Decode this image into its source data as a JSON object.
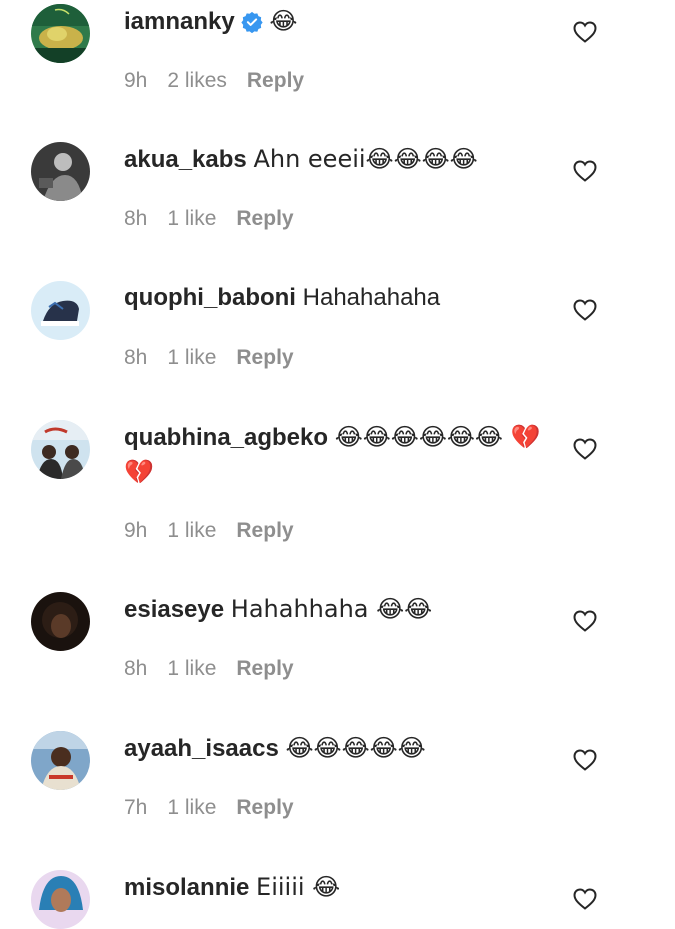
{
  "comments": [
    {
      "username": "iamnanky",
      "verified": true,
      "text": "😂",
      "time": "9h",
      "likes": "2 likes",
      "reply": "Reply"
    },
    {
      "username": "akua_kabs",
      "verified": false,
      "text": "Ahn eeeii😂😂😂😂",
      "time": "8h",
      "likes": "1 like",
      "reply": "Reply"
    },
    {
      "username": "quophi_baboni",
      "verified": false,
      "text": "Hahahahaha",
      "time": "8h",
      "likes": "1 like",
      "reply": "Reply"
    },
    {
      "username": "quabhina_agbeko",
      "verified": false,
      "text": "😂😂😂😂😂😂 💔💔",
      "time": "9h",
      "likes": "1 like",
      "reply": "Reply"
    },
    {
      "username": "esiaseye",
      "verified": false,
      "text": "Hahahhaha 😂😂",
      "time": "8h",
      "likes": "1 like",
      "reply": "Reply"
    },
    {
      "username": "ayaah_isaacs",
      "verified": false,
      "text": "😂😂😂😂😂",
      "time": "7h",
      "likes": "1 like",
      "reply": "Reply"
    },
    {
      "username": "misolannie",
      "verified": false,
      "text": "Eiiiii 😂",
      "time": "",
      "likes": "",
      "reply": ""
    }
  ],
  "colors": {
    "text": "#262626",
    "meta": "#8e8e8e",
    "verified": "#3897f0"
  },
  "icons": {
    "like": "heart-outline-icon",
    "verified": "verified-badge-icon"
  }
}
